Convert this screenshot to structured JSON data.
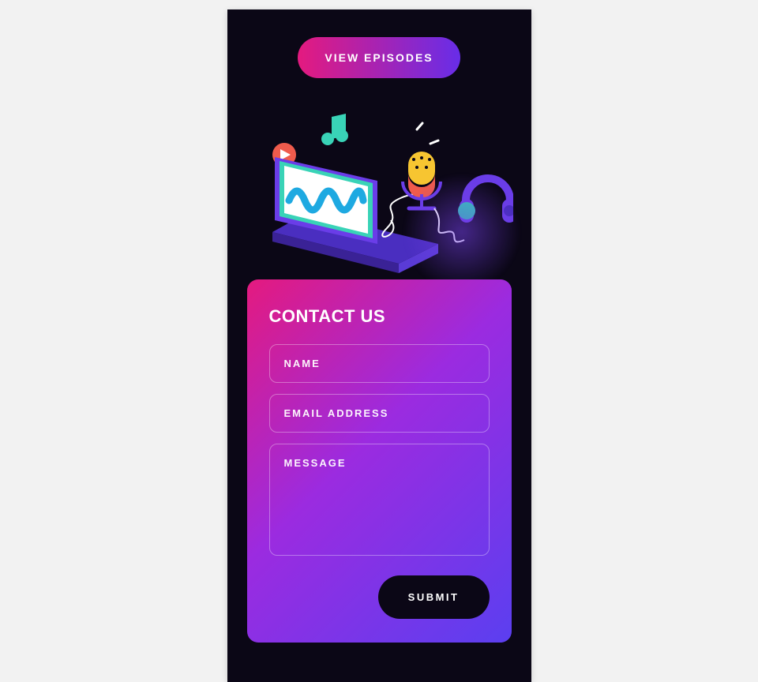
{
  "header": {
    "view_episodes_label": "View Episodes"
  },
  "illustration": {
    "laptop_icon": "laptop",
    "play_icon": "play",
    "music_note_icon": "music-note",
    "mic_icon": "microphone",
    "headphones_icon": "headphones",
    "colors": {
      "laptop_body": "#6a3de8",
      "laptop_screen_border": "#39d3b7",
      "laptop_screen": "#ffffff",
      "waveform": "#1ea9e1",
      "play_circle": "#ef5b4c",
      "mic_top": "#f7c531",
      "mic_bottom": "#ef5b4c",
      "headphones": "#6a3de8",
      "headphones_cup": "#2ed1b5",
      "note": "#39d3b7"
    }
  },
  "contact": {
    "title": "Contact Us",
    "name_placeholder": "Name",
    "email_placeholder": "Email Address",
    "message_placeholder": "Message",
    "submit_label": "Submit"
  }
}
